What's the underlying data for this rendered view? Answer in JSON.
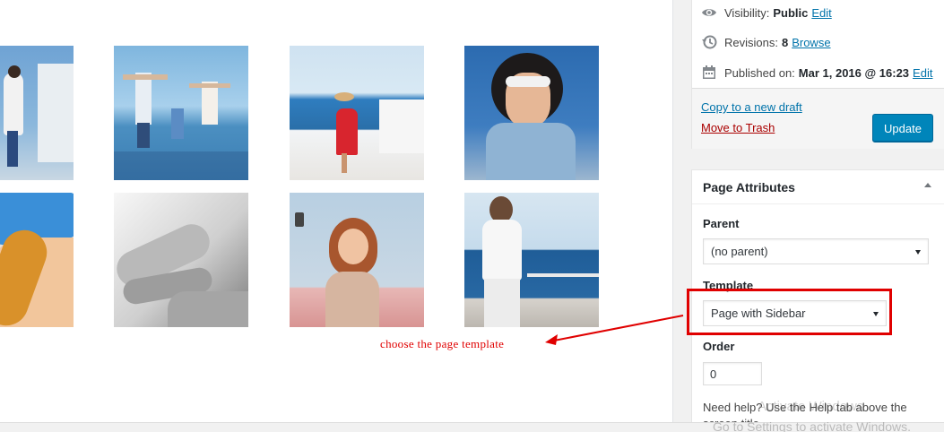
{
  "publish": {
    "visibility_label": "Visibility:",
    "visibility_value": "Public",
    "visibility_edit": "Edit",
    "revisions_label": "Revisions:",
    "revisions_value": "8",
    "revisions_browse": "Browse",
    "published_label": "Published on:",
    "published_value": "Mar 1, 2016 @ 16:23",
    "published_edit": "Edit",
    "copy_draft": "Copy to a new draft",
    "trash": "Move to Trash",
    "update": "Update"
  },
  "page_attributes": {
    "title": "Page Attributes",
    "parent_label": "Parent",
    "parent_value": "(no parent)",
    "template_label": "Template",
    "template_value": "Page with Sidebar",
    "order_label": "Order",
    "order_value": "0",
    "help_text": "Need help? Use the Help tab above the screen title."
  },
  "annotation": "choose the page template",
  "watermark": {
    "line1": "Activate Windows",
    "line2": "Go to Settings to activate Windows."
  },
  "gallery": {
    "images": [
      "photo",
      "photo",
      "photo",
      "photo",
      "photo",
      "photo",
      "photo",
      "photo"
    ]
  },
  "colors": {
    "accent": "#0085ba",
    "link": "#0073aa",
    "trash": "#aa0000",
    "annotation": "#e00000"
  }
}
